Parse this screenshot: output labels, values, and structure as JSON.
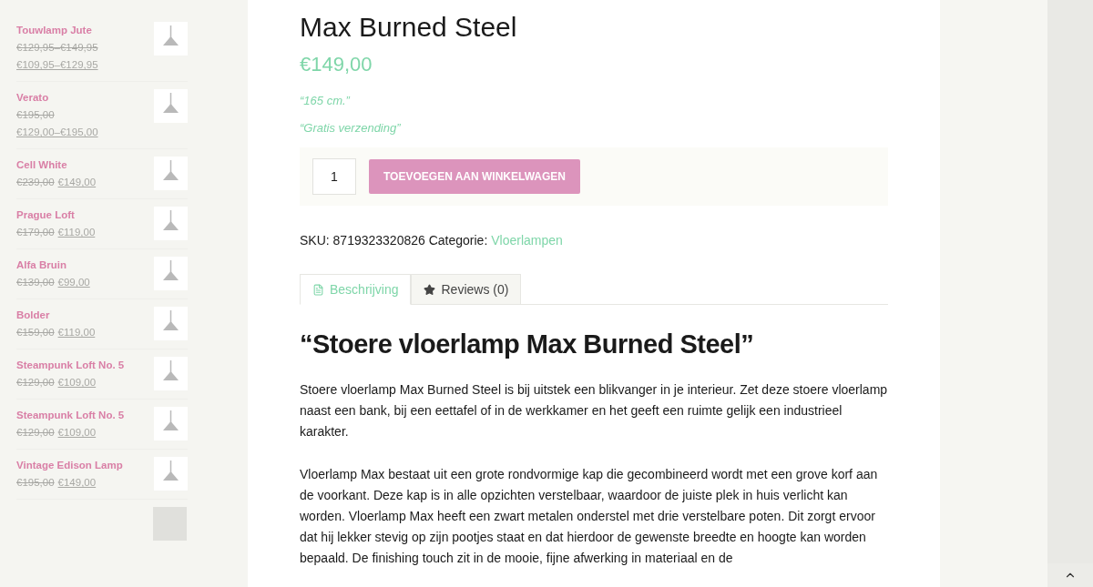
{
  "sidebar": {
    "products": [
      {
        "name": "Touwlamp Jute",
        "old_price": "€129,95–€149,95",
        "price": "€109,95–€129,95"
      },
      {
        "name": "Verato",
        "old_price": "€195,00",
        "price": "€129,00–€195,00"
      },
      {
        "name": "Cell White",
        "old_price": "€239,00",
        "price": "€149,00"
      },
      {
        "name": "Prague Loft",
        "old_price": "€179,00",
        "price": "€119,00"
      },
      {
        "name": "Alfa Bruin",
        "old_price": "€139,00",
        "price": "€99,00"
      },
      {
        "name": "Bolder",
        "old_price": "€159,00",
        "price": "€119,00"
      },
      {
        "name": "Steampunk Loft No. 5",
        "old_price": "€129,00",
        "price": "€109,00"
      },
      {
        "name": "Steampunk Loft No. 5",
        "old_price": "€129,00",
        "price": "€109,00"
      },
      {
        "name": "Vintage Edison Lamp",
        "old_price": "€195,00",
        "price": "€149,00"
      }
    ]
  },
  "product": {
    "title": "Max Burned Steel",
    "price": "€149,00",
    "notes": [
      "“165 cm.”",
      "“Gratis verzending”"
    ],
    "quantity": "1",
    "add_to_cart": "TOEVOEGEN AAN WINKELWAGEN",
    "sku": "SKU: 8719323320826 Categorie:",
    "category": "Vloerlampen",
    "tabs": [
      {
        "label": "Beschrijving",
        "kind": "description",
        "selected": true
      },
      {
        "label": "Reviews (0)",
        "kind": "reviews",
        "selected": false
      }
    ],
    "heading": "“Stoere vloerlamp Max Burned Steel”",
    "paragraphs": [
      "Stoere vloerlamp Max Burned Steel is bij uitstek een blikvanger in je interieur. Zet deze stoere vloerlamp naast een bank, bij een eettafel of in de werkkamer en het geeft een ruimte gelijk een industrieel karakter.",
      "Vloerlamp Max bestaat uit een grote rondvormige kap die gecombineerd wordt met een grove korf aan de voorkant. Deze kap is in alle opzichten verstelbaar, waardoor de juiste plek in huis verlicht kan worden. Vloerlamp Max heeft een zwart metalen onderstel met drie verstelbare poten. Dit zorgt ervoor dat hij lekker stevig op zijn pootjes staat en dat hierdoor de gewenste breedte en hoogte kan worden bepaald. De finishing touch zit in de mooie, fijne afwerking in materiaal en de"
    ]
  }
}
